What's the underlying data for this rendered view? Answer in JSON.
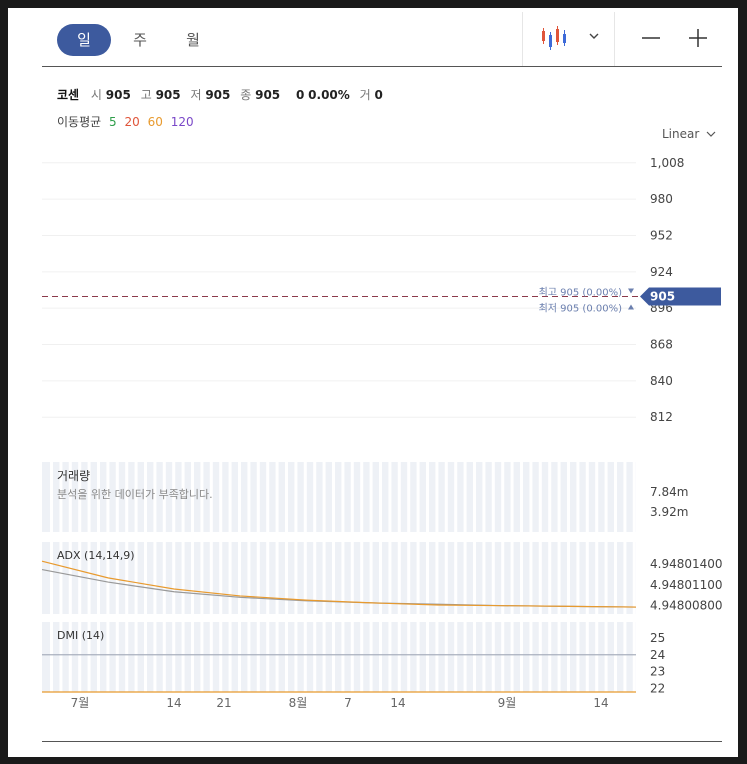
{
  "tabs": [
    {
      "id": "day",
      "label": "일",
      "active": true
    },
    {
      "id": "week",
      "label": "주",
      "active": false
    },
    {
      "id": "month",
      "label": "월",
      "active": false
    }
  ],
  "toolbar": {
    "chart_type_icon": "candlestick-icon",
    "dropdown_icon": "chevron-down-icon",
    "zoom_out_icon": "minus-icon",
    "zoom_in_icon": "plus-icon"
  },
  "summary": {
    "name": "코센",
    "open_label": "시",
    "open": "905",
    "high_label": "고",
    "high": "905",
    "low_label": "저",
    "low": "905",
    "close_label": "종",
    "close": "905",
    "change": "0",
    "change_pct": "0.00%",
    "volume_label": "거",
    "volume": "0"
  },
  "moving_average": {
    "label": "이동평균",
    "periods": [
      {
        "value": "5",
        "color": "#2e9e4a"
      },
      {
        "value": "20",
        "color": "#e0553a"
      },
      {
        "value": "60",
        "color": "#e89a2e"
      },
      {
        "value": "120",
        "color": "#7a48c8"
      }
    ]
  },
  "scale_toggle": "Linear",
  "colors": {
    "accent": "#3d5a9e",
    "price_line": "#8b3a4a",
    "adx_line": "#e89a2e",
    "pdi_line": "#999999",
    "dmi_line": "#aab0be",
    "grid": "#f0f0f0"
  },
  "chart_data": [
    {
      "type": "line",
      "id": "price",
      "ylim": [
        796,
        1024
      ],
      "yticks": [
        "1,008",
        "980",
        "952",
        "924",
        "896",
        "868",
        "840",
        "812"
      ],
      "ytick_values": [
        1008,
        980,
        952,
        924,
        896,
        868,
        840,
        812
      ],
      "series": [
        {
          "values": [
            905,
            905
          ]
        }
      ],
      "current_price": "905",
      "current_price_value": 905,
      "high_marker": {
        "label": "최고",
        "value": "905",
        "pct": "(0.00%)"
      },
      "low_marker": {
        "label": "최저",
        "value": "905",
        "pct": "(0.00%)"
      }
    },
    {
      "type": "bar",
      "id": "volume",
      "title": "거래량",
      "message": "분석을 위한 데이터가 부족합니다.",
      "yticks": [
        "7.84m",
        "3.92m"
      ]
    },
    {
      "type": "line",
      "id": "adx",
      "title": "ADX (14,14,9)",
      "yticks": [
        "4.94801400",
        "4.94801100",
        "4.94800800"
      ],
      "ytick_values": [
        4.948014,
        4.948011,
        4.948008
      ],
      "ylim": [
        4.9480068,
        4.9480163
      ],
      "series": [
        {
          "values": [
            4.9480144,
            4.948012,
            4.9480104,
            4.9480094,
            4.9480088,
            4.9480084,
            4.9480081,
            4.948008,
            4.9480079,
            4.9480078
          ]
        },
        {
          "values": [
            4.9480132,
            4.9480114,
            4.94801,
            4.9480092,
            4.9480087,
            4.9480084,
            4.9480082,
            4.948008,
            4.9480079,
            4.9480078
          ]
        }
      ]
    },
    {
      "type": "line",
      "id": "dmi",
      "title": "DMI (14)",
      "yticks": [
        "25",
        "24",
        "23",
        "22"
      ],
      "ytick_values": [
        25,
        24,
        23,
        22
      ],
      "ylim": [
        21.8,
        25.7
      ],
      "series": [
        {
          "values": [
            24,
            24
          ]
        },
        {
          "values": [
            21.8,
            21.8
          ]
        }
      ]
    }
  ],
  "xaxis_labels": [
    "7월",
    "14",
    "21",
    "8월",
    "7",
    "14",
    "9월",
    "14"
  ]
}
